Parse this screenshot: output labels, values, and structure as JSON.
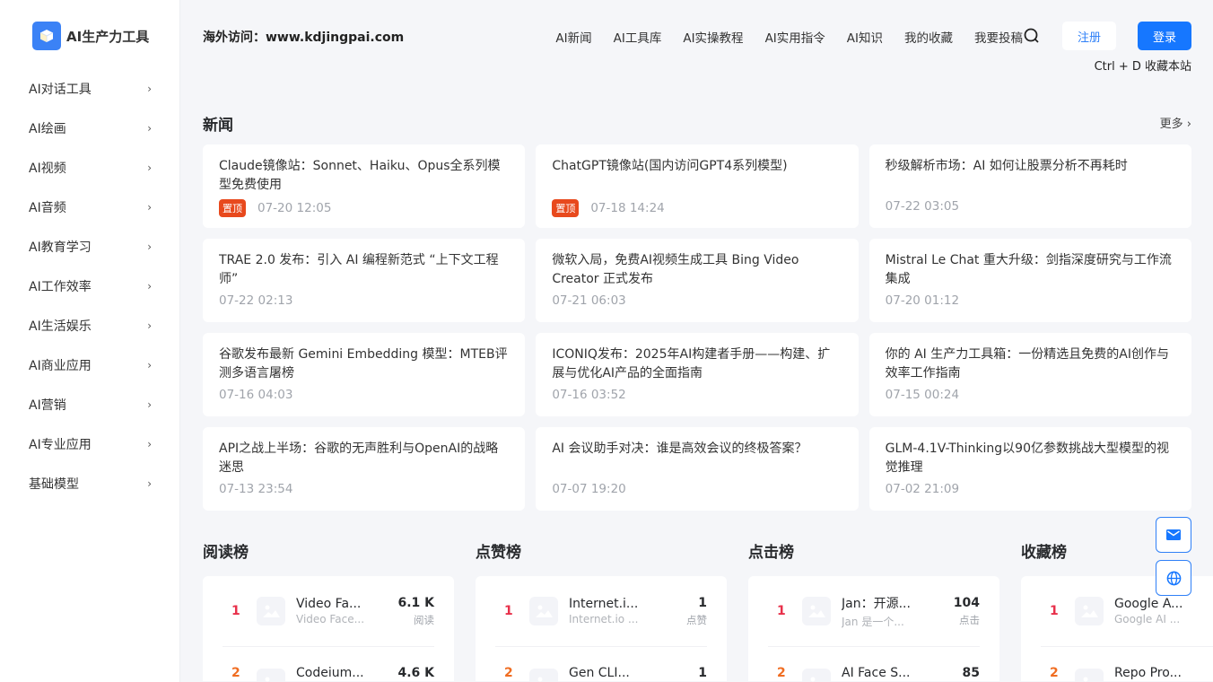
{
  "brand": {
    "name": "AI生产力工具"
  },
  "sidebar": {
    "items": [
      {
        "label": "AI对话工具"
      },
      {
        "label": "AI绘画"
      },
      {
        "label": "AI视频"
      },
      {
        "label": "AI音频"
      },
      {
        "label": "AI教育学习"
      },
      {
        "label": "AI工作效率"
      },
      {
        "label": "AI生活娱乐"
      },
      {
        "label": "AI商业应用"
      },
      {
        "label": "AI营销"
      },
      {
        "label": "AI专业应用"
      },
      {
        "label": "基础模型"
      }
    ]
  },
  "header": {
    "site": "海外访问：www.kdjingpai.com",
    "nav": [
      "AI新闻",
      "AI工具库",
      "AI实操教程",
      "AI实用指令",
      "AI知识",
      "我的收藏",
      "我要投稿"
    ],
    "register": "注册",
    "login": "登录",
    "bookmark_hint": "Ctrl + D 收藏本站"
  },
  "news": {
    "title": "新闻",
    "more": "更多",
    "pin_label": "置顶",
    "items": [
      {
        "title": "Claude镜像站：Sonnet、Haiku、Opus全系列模型免费使用",
        "time": "07-20 12:05",
        "pinned": true
      },
      {
        "title": "ChatGPT镜像站(国内访问GPT4系列模型)",
        "time": "07-18 14:24",
        "pinned": true
      },
      {
        "title": "秒级解析市场：AI 如何让股票分析不再耗时",
        "time": "07-22 03:05"
      },
      {
        "title": "TRAE 2.0 发布：引入 AI 编程新范式 “上下文工程师”",
        "time": "07-22 02:13"
      },
      {
        "title": "微软入局，免费AI视频生成工具 Bing Video Creator 正式发布",
        "time": "07-21 06:03"
      },
      {
        "title": "Mistral Le Chat 重大升级：剑指深度研究与工作流集成",
        "time": "07-20 01:12"
      },
      {
        "title": "谷歌发布最新 Gemini Embedding 模型：MTEB评测多语言屠榜",
        "time": "07-16 04:03"
      },
      {
        "title": "ICONIQ发布：2025年AI构建者手册——构建、扩展与优化AI产品的全面指南",
        "time": "07-16 03:52"
      },
      {
        "title": "你的 AI 生产力工具箱：一份精选且免费的AI创作与效率工作指南",
        "time": "07-15 00:24"
      },
      {
        "title": "API之战上半场：谷歌的无声胜利与OpenAI的战略迷思",
        "time": "07-13 23:54"
      },
      {
        "title": "AI 会议助手对决：谁是高效会议的终极答案？",
        "time": "07-07 19:20"
      },
      {
        "title": "GLM-4.1V-Thinking以90亿参数挑战大型模型的视觉推理",
        "time": "07-02 21:09"
      }
    ]
  },
  "rankings": [
    {
      "title": "阅读榜",
      "unit": "阅读",
      "items": [
        {
          "rank": "1",
          "name": "Video Fa...",
          "desc": "Video Face...",
          "value": "6.1 K"
        },
        {
          "rank": "2",
          "name": "Codeium...",
          "desc": "",
          "value": "4.6 K"
        }
      ]
    },
    {
      "title": "点赞榜",
      "unit": "点赞",
      "items": [
        {
          "rank": "1",
          "name": "Internet.i...",
          "desc": "Internet.io ...",
          "value": "1"
        },
        {
          "rank": "2",
          "name": "Gen CLI...",
          "desc": "",
          "value": "1"
        }
      ]
    },
    {
      "title": "点击榜",
      "unit": "点击",
      "items": [
        {
          "rank": "1",
          "name": "Jan：开源...",
          "desc": "Jan 是一个...",
          "value": "104"
        },
        {
          "rank": "2",
          "name": "AI Face S...",
          "desc": "",
          "value": "85"
        }
      ]
    },
    {
      "title": "收藏榜",
      "unit": "",
      "items": [
        {
          "rank": "1",
          "name": "Google A...",
          "desc": "Google AI ...",
          "value": ""
        },
        {
          "rank": "2",
          "name": "Repo Pro...",
          "desc": "",
          "value": ""
        }
      ]
    }
  ]
}
